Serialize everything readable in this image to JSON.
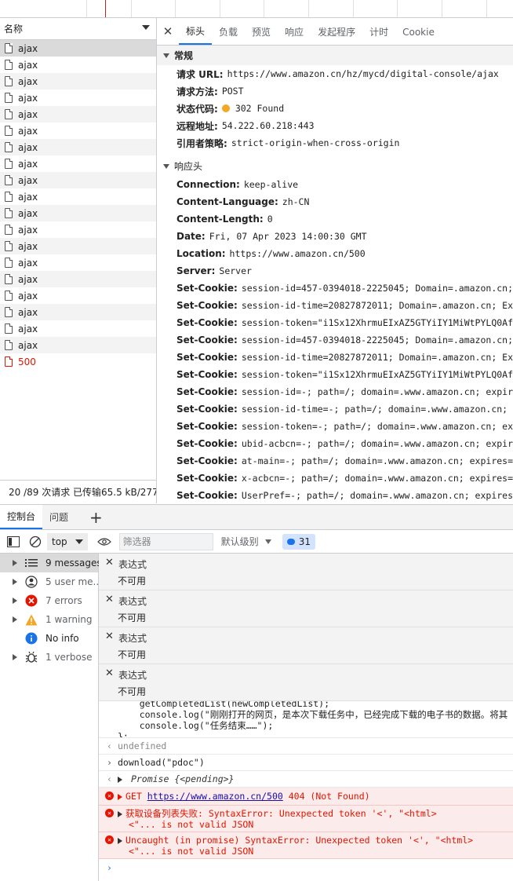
{
  "request_list": {
    "header": "名称",
    "items": [
      "ajax",
      "ajax",
      "ajax",
      "ajax",
      "ajax",
      "ajax",
      "ajax",
      "ajax",
      "ajax",
      "ajax",
      "ajax",
      "ajax",
      "ajax",
      "ajax",
      "ajax",
      "ajax",
      "ajax",
      "ajax",
      "ajax",
      "500"
    ],
    "status": "20 /89 次请求  已传输65.5 kB/277 k"
  },
  "detail_tabs": [
    "标头",
    "负载",
    "预览",
    "响应",
    "发起程序",
    "计时",
    "Cookie"
  ],
  "general": {
    "title": "常规",
    "fields": [
      {
        "k": "请求 URL:",
        "v": "https://www.amazon.cn/hz/mycd/digital-console/ajax"
      },
      {
        "k": "请求方法:",
        "v": "POST"
      },
      {
        "k": "状态代码:",
        "v": "302 Found"
      },
      {
        "k": "远程地址:",
        "v": "54.222.60.218:443"
      },
      {
        "k": "引用者策略:",
        "v": "strict-origin-when-cross-origin"
      }
    ]
  },
  "response_headers": {
    "title": "响应头",
    "fields": [
      {
        "k": "Connection:",
        "v": "keep-alive"
      },
      {
        "k": "Content-Language:",
        "v": "zh-CN"
      },
      {
        "k": "Content-Length:",
        "v": "0"
      },
      {
        "k": "Date:",
        "v": "Fri, 07 Apr 2023 14:00:30 GMT"
      },
      {
        "k": "Location:",
        "v": "https://www.amazon.cn/500"
      },
      {
        "k": "Server:",
        "v": "Server"
      },
      {
        "k": "Set-Cookie:",
        "v": "session-id=457-0394018-2225045; Domain=.amazon.cn; Expi"
      },
      {
        "k": "Set-Cookie:",
        "v": "session-id-time=20827872011; Domain=.amazon.cn; Expires"
      },
      {
        "k": "Set-Cookie:",
        "v": "session-token=\"i1Sx12XhrmuEIxAZ5GTYiIY1MiWtPYLQ0Afn+Uaj"
      },
      {
        "k": "Set-Cookie:",
        "v": "session-id=457-0394018-2225045; Domain=.amazon.cn; Expi"
      },
      {
        "k": "Set-Cookie:",
        "v": "session-id-time=20827872011; Domain=.amazon.cn; Expires"
      },
      {
        "k": "Set-Cookie:",
        "v": "session-token=\"i1Sx12XhrmuEIxAZ5GTYiIY1MiWtPYLQ0Afn+Uaj"
      },
      {
        "k": "Set-Cookie:",
        "v": "session-id=-; path=/; domain=.www.amazon.cn; expires=Th"
      },
      {
        "k": "Set-Cookie:",
        "v": "session-id-time=-; path=/; domain=.www.amazon.cn; expir"
      },
      {
        "k": "Set-Cookie:",
        "v": "session-token=-; path=/; domain=.www.amazon.cn; expires"
      },
      {
        "k": "Set-Cookie:",
        "v": "ubid-acbcn=-; path=/; domain=.www.amazon.cn; expires=Th"
      },
      {
        "k": "Set-Cookie:",
        "v": "at-main=-; path=/; domain=.www.amazon.cn; expires=Thu,"
      },
      {
        "k": "Set-Cookie:",
        "v": "x-acbcn=-; path=/; domain=.www.amazon.cn; expires=Thu,"
      },
      {
        "k": "Set-Cookie:",
        "v": "UserPref=-; path=/; domain=.www.amazon.cn; expires=Thu,"
      }
    ]
  },
  "drawer_tabs": [
    "控制台",
    "问题"
  ],
  "console_toolbar": {
    "context": "top",
    "filter_placeholder": "筛选器",
    "levels": "默认级别",
    "issues_count": "31"
  },
  "console_sidebar": [
    {
      "label": "9 messages"
    },
    {
      "label": "5 user me..."
    },
    {
      "label": "7 errors"
    },
    {
      "label": "1 warning"
    },
    {
      "label": "No info"
    },
    {
      "label": "1 verbose"
    }
  ],
  "live_expressions": [
    {
      "label": "表达式",
      "value": "不可用"
    },
    {
      "label": "表达式",
      "value": "不可用"
    },
    {
      "label": "表达式",
      "value": "不可用"
    },
    {
      "label": "表达式",
      "value": "不可用"
    }
  ],
  "console": {
    "code_lines": [
      "    getCompletedList(newCompletedList);",
      "    console.log(\"刚刚打开的网页，是本次下载任务中，已经完成下载的电子书的数据。将其",
      "    console.log(\"任务结束……\");",
      "};"
    ],
    "undefined_text": "undefined",
    "input_cmd": "download(\"pdoc\")",
    "promise_text": "Promise {<pending>}",
    "err1_prefix": "GET ",
    "err1_link": "https://www.amazon.cn/500",
    "err1_suffix": " 404 (Not Found)",
    "err2_line1": "获取设备列表失败: SyntaxError: Unexpected token '<', \"<html>",
    "err2_line2": "<\"... is not valid JSON",
    "err3_line1": "Uncaught (in promise) SyntaxError: Unexpected token '<', \"<html>",
    "err3_line2": "<\"... is not valid JSON"
  }
}
